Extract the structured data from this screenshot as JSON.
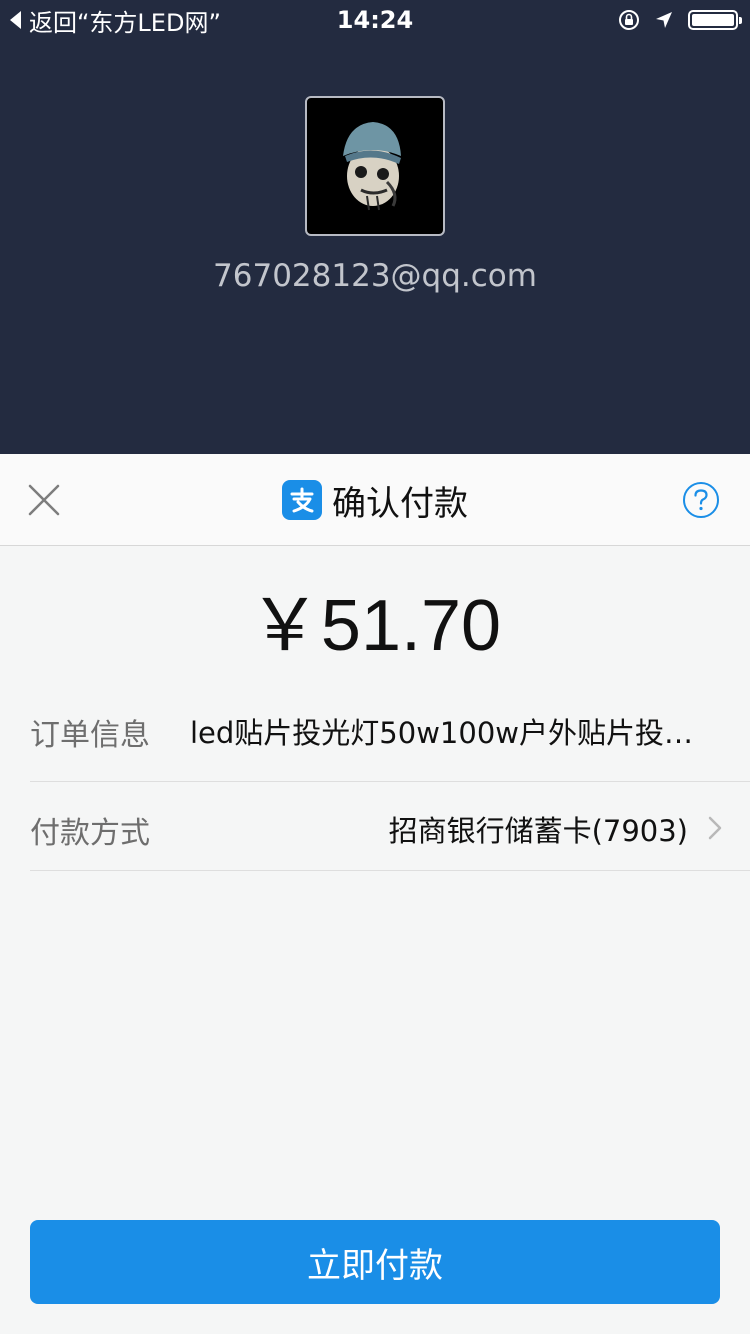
{
  "status_bar": {
    "back_text": "返回“东方LED网”",
    "time": "14:24"
  },
  "profile": {
    "account": "767028123@qq.com"
  },
  "sheet": {
    "title": "确认付款",
    "amount": "￥51.70",
    "order_label": "订单信息",
    "order_value": "led贴片投光灯50w100w户外贴片投…",
    "payment_label": "付款方式",
    "payment_value": "招商银行储蓄卡(7903)",
    "pay_button": "立即付款"
  },
  "colors": {
    "header_bg": "#232b40",
    "accent": "#1a8ee7",
    "sheet_bg": "#f5f6f6"
  },
  "icons": {
    "back": "back-arrow-icon",
    "orientation_lock": "orientation-lock-icon",
    "location": "location-icon",
    "battery": "battery-icon",
    "close": "close-icon",
    "brand": "alipay-logo-icon",
    "help": "help-icon",
    "chevron": "chevron-right-icon"
  }
}
